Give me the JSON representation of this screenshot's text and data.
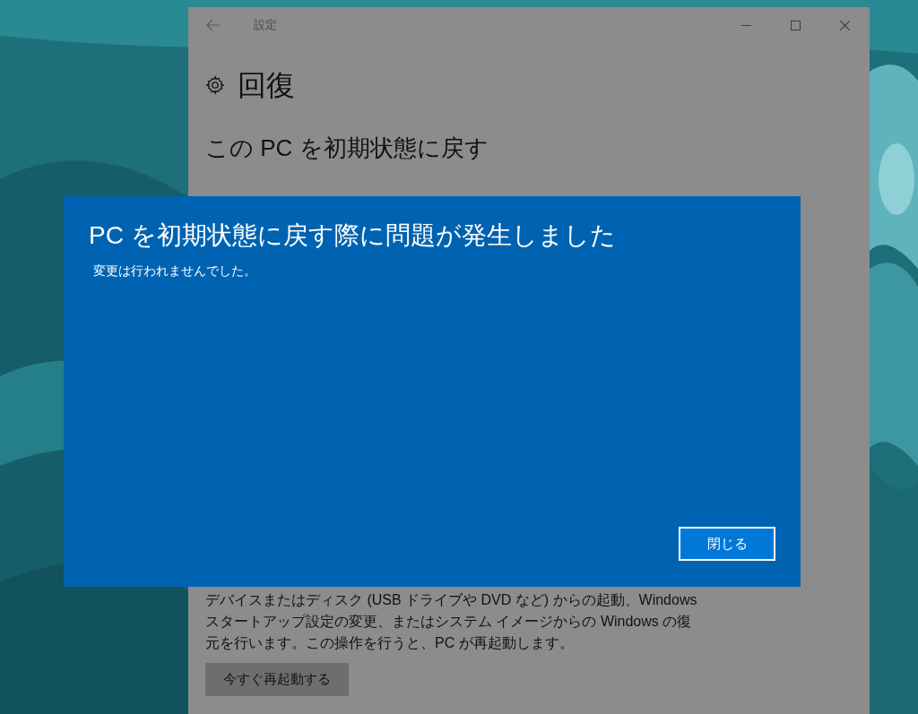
{
  "window": {
    "title": "設定"
  },
  "page": {
    "heading": "回復",
    "section_title": "この PC を初期状態に戻す",
    "description": "デバイスまたはディスク (USB ドライブや DVD など) からの起動、Windows スタートアップ設定の変更、またはシステム イメージからの Windows の復元を行います。この操作を行うと、PC が再起動します。",
    "button": "今すぐ再起動する"
  },
  "dialog": {
    "title": "PC を初期状態に戻す際に問題が発生しました",
    "message": "変更は行われませんでした。",
    "button": "閉じる"
  }
}
